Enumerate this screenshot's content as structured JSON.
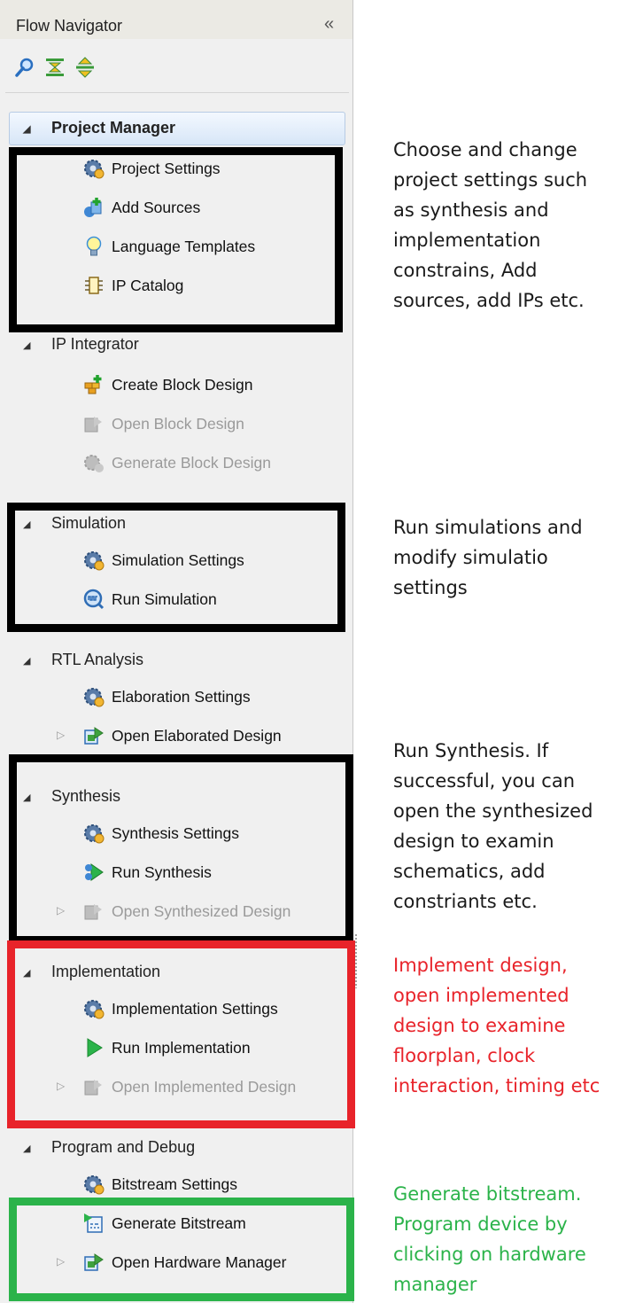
{
  "header": {
    "title": "Flow Navigator",
    "collapse_glyph": "«"
  },
  "toolbar": {
    "icons": [
      "search-icon",
      "collapse-all-icon",
      "expand-all-icon"
    ]
  },
  "sections": {
    "project_manager": {
      "label": "Project Manager",
      "items": [
        "Project Settings",
        "Add Sources",
        "Language Templates",
        "IP Catalog"
      ]
    },
    "ip_integrator": {
      "label": "IP Integrator",
      "items": [
        "Create Block Design",
        "Open Block Design",
        "Generate Block Design"
      ]
    },
    "simulation": {
      "label": "Simulation",
      "items": [
        "Simulation Settings",
        "Run Simulation"
      ]
    },
    "rtl_analysis": {
      "label": "RTL Analysis",
      "items": [
        "Elaboration Settings",
        "Open Elaborated Design"
      ]
    },
    "synthesis": {
      "label": "Synthesis",
      "items": [
        "Synthesis Settings",
        "Run Synthesis",
        "Open Synthesized Design"
      ]
    },
    "implementation": {
      "label": "Implementation",
      "items": [
        "Implementation Settings",
        "Run Implementation",
        "Open Implemented Design"
      ]
    },
    "program_debug": {
      "label": "Program and Debug",
      "items": [
        "Bitstream Settings",
        "Generate Bitstream",
        "Open Hardware Manager"
      ]
    }
  },
  "annotations": {
    "project_manager": "Choose and change\nproject settings such\nas synthesis and\nimplementation\nconstrains, Add\nsources, add IPs etc.",
    "simulation": "Run simulations and\nmodify simulatio\nsettings",
    "synthesis": "Run Synthesis. If\nsuccessful, you can\nopen the synthesized\ndesign to examin\nschematics, add\nconstriants etc.",
    "implementation": "Implement design,\nopen implemented\ndesign to examine\nfloorplan, clock\ninteraction, timing etc",
    "program_debug": "Generate bitstream.\nProgram device by\nclicking on hardware\nmanager"
  },
  "colors": {
    "black_box": "#000000",
    "red_box": "#e8232a",
    "green_box": "#2bb34a",
    "red_text": "#e8232a",
    "green_text": "#2bb34a"
  }
}
